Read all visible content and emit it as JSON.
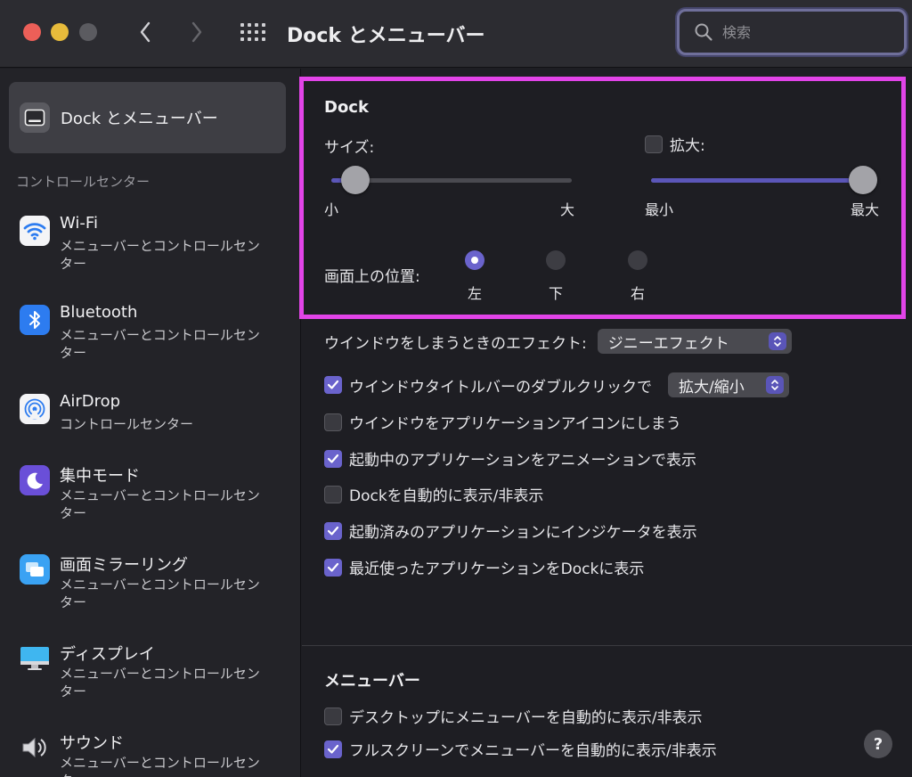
{
  "window": {
    "title": "Dock とメニューバー"
  },
  "search": {
    "placeholder": "検索"
  },
  "sidebar": {
    "selected": {
      "label": "Dock とメニューバー"
    },
    "section_label": "コントロールセンター",
    "items": [
      {
        "title": "Wi-Fi",
        "subtitle": "メニューバーとコントロールセンター",
        "icon": "wifi-icon"
      },
      {
        "title": "Bluetooth",
        "subtitle": "メニューバーとコントロールセンター",
        "icon": "bluetooth-icon"
      },
      {
        "title": "AirDrop",
        "subtitle": "コントロールセンター",
        "icon": "airdrop-icon"
      },
      {
        "title": "集中モード",
        "subtitle": "メニューバーとコントロールセンター",
        "icon": "moon-icon"
      },
      {
        "title": "画面ミラーリング",
        "subtitle": "メニューバーとコントロールセンター",
        "icon": "screen-mirroring-icon"
      },
      {
        "title": "ディスプレイ",
        "subtitle": "メニューバーとコントロールセンター",
        "icon": "display-icon"
      },
      {
        "title": "サウンド",
        "subtitle": "メニューバーとコントロールセンター",
        "icon": "speaker-icon"
      }
    ]
  },
  "dock": {
    "heading": "Dock",
    "size": {
      "label": "サイズ:",
      "min_label": "小",
      "max_label": "大",
      "value": 0.1
    },
    "magnification": {
      "label": "拡大:",
      "checked": false,
      "min_label": "最小",
      "max_label": "最大",
      "value": 1.0
    },
    "position": {
      "label": "画面上の位置:",
      "options": [
        {
          "label": "左",
          "selected": true
        },
        {
          "label": "下",
          "selected": false
        },
        {
          "label": "右",
          "selected": false
        }
      ]
    },
    "minimize_effect": {
      "label": "ウインドウをしまうときのエフェクト:",
      "value": "ジニーエフェクト"
    },
    "double_click": {
      "label": "ウインドウタイトルバーのダブルクリックで",
      "checked": true,
      "value": "拡大/縮小"
    },
    "options": [
      {
        "label": "ウインドウをアプリケーションアイコンにしまう",
        "checked": false
      },
      {
        "label": "起動中のアプリケーションをアニメーションで表示",
        "checked": true
      },
      {
        "label": "Dockを自動的に表示/非表示",
        "checked": false
      },
      {
        "label": "起動済みのアプリケーションにインジケータを表示",
        "checked": true
      },
      {
        "label": "最近使ったアプリケーションをDockに表示",
        "checked": true
      }
    ]
  },
  "menubar": {
    "heading": "メニューバー",
    "options": [
      {
        "label": "デスクトップにメニューバーを自動的に表示/非表示",
        "checked": false
      },
      {
        "label": "フルスクリーンでメニューバーを自動的に表示/非表示",
        "checked": true
      }
    ]
  },
  "help": {
    "label": "?"
  },
  "colors": {
    "accent": "#6a63cc",
    "highlight": "#e244e8",
    "close": "#ec5f58",
    "minimize": "#e7bb3b"
  }
}
